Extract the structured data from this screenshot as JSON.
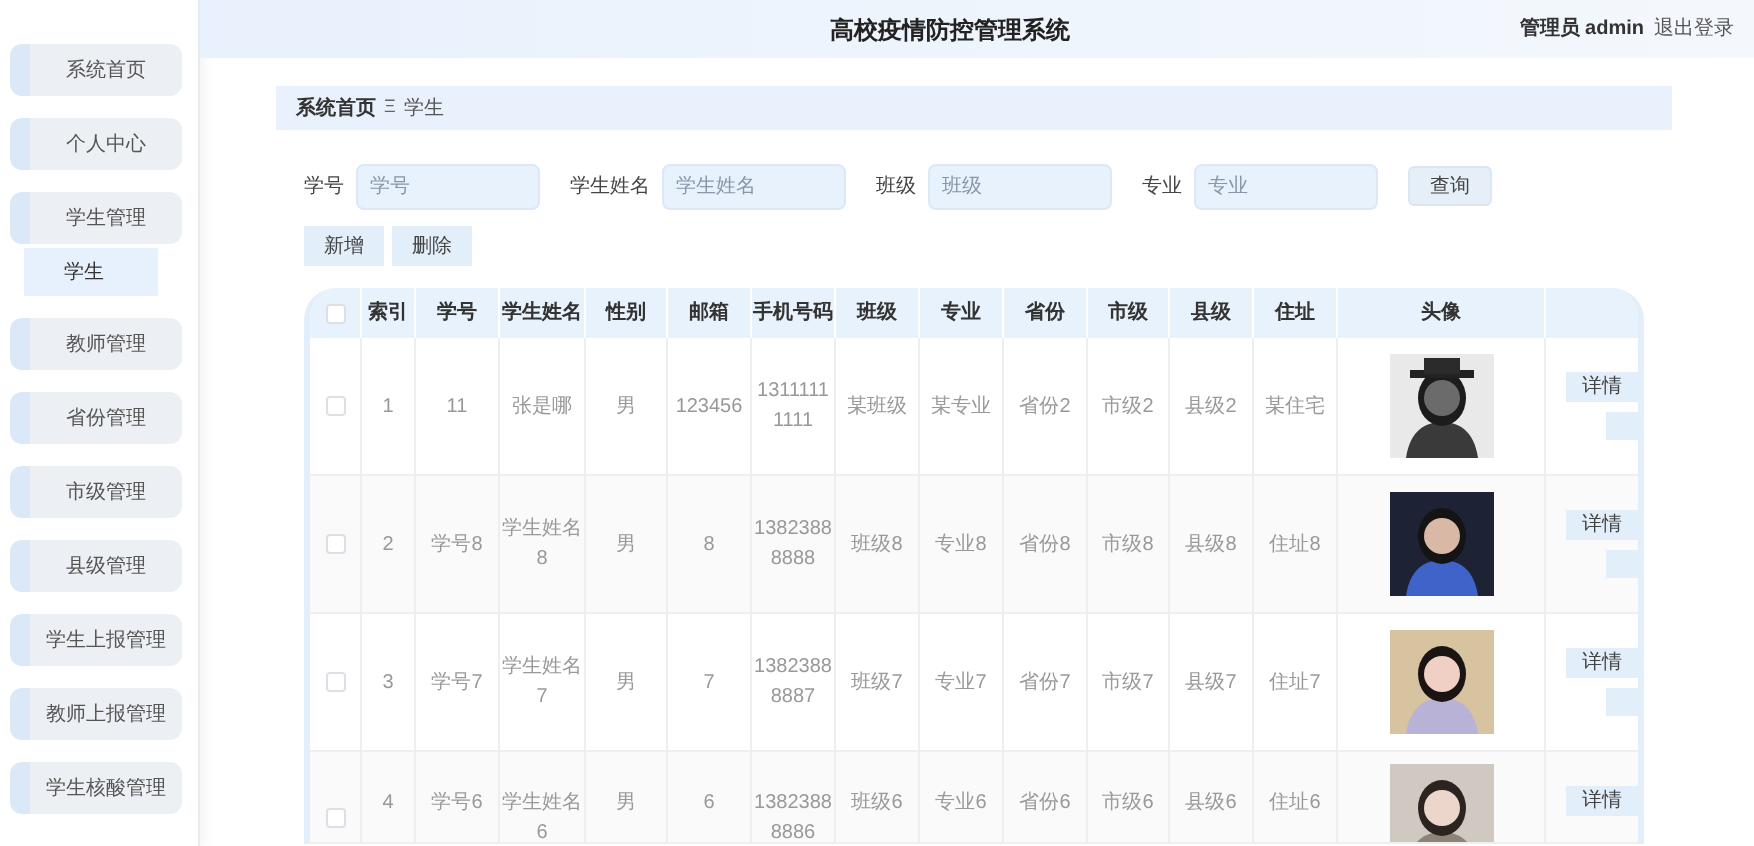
{
  "header": {
    "title": "高校疫情防控管理系统",
    "user": "管理员 admin",
    "logout": "退出登录"
  },
  "sidebar": {
    "items": [
      {
        "label": "系统首页"
      },
      {
        "label": "个人中心"
      },
      {
        "label": "学生管理",
        "children": [
          {
            "label": "学生",
            "selected": true
          }
        ]
      },
      {
        "label": "教师管理"
      },
      {
        "label": "省份管理"
      },
      {
        "label": "市级管理"
      },
      {
        "label": "县级管理"
      },
      {
        "label": "学生上报管理"
      },
      {
        "label": "教师上报管理"
      },
      {
        "label": "学生核酸管理"
      }
    ]
  },
  "breadcrumb": {
    "items": [
      "系统首页",
      "学生"
    ],
    "separator": "Ξ"
  },
  "filters": [
    {
      "label": "学号",
      "placeholder": "学号"
    },
    {
      "label": "学生姓名",
      "placeholder": "学生姓名"
    },
    {
      "label": "班级",
      "placeholder": "班级"
    },
    {
      "label": "专业",
      "placeholder": "专业"
    }
  ],
  "query_button": "查询",
  "actions": [
    "新增",
    "删除"
  ],
  "table": {
    "header_checked": false,
    "columns": [
      "索引",
      "学号",
      "学生姓名",
      "性别",
      "邮箱",
      "手机号码",
      "班级",
      "专业",
      "省份",
      "市级",
      "县级",
      "住址",
      "头像"
    ],
    "rows": [
      {
        "checked": false,
        "cells": [
          "1",
          "11",
          "张是哪",
          "男",
          "123456",
          "13111111111",
          "某班级",
          "某专业",
          "省份2",
          "市级2",
          "县级2",
          "某住宅"
        ],
        "avatar": {
          "kind": "picture"
        },
        "detail_button": "详情"
      },
      {
        "checked": false,
        "cells": [
          "2",
          "学号8",
          "学生姓名8",
          "男",
          "8",
          "13823888888",
          "班级8",
          "专业8",
          "省份8",
          "市级8",
          "县级8",
          "住址8"
        ],
        "avatar": {
          "kind": "picture"
        },
        "detail_button": "详情"
      },
      {
        "checked": false,
        "cells": [
          "3",
          "学号7",
          "学生姓名7",
          "男",
          "7",
          "13823888887",
          "班级7",
          "专业7",
          "省份7",
          "市级7",
          "县级7",
          "住址7"
        ],
        "avatar": {
          "kind": "picture"
        },
        "detail_button": "详情"
      },
      {
        "checked": false,
        "cells": [
          "4",
          "学号6",
          "学生姓名6",
          "男",
          "6",
          "13823888886",
          "班级6",
          "专业6",
          "省份6",
          "市级6",
          "县级6",
          "住址6"
        ],
        "avatar": {
          "kind": "picture"
        },
        "detail_button": "详情"
      }
    ]
  }
}
